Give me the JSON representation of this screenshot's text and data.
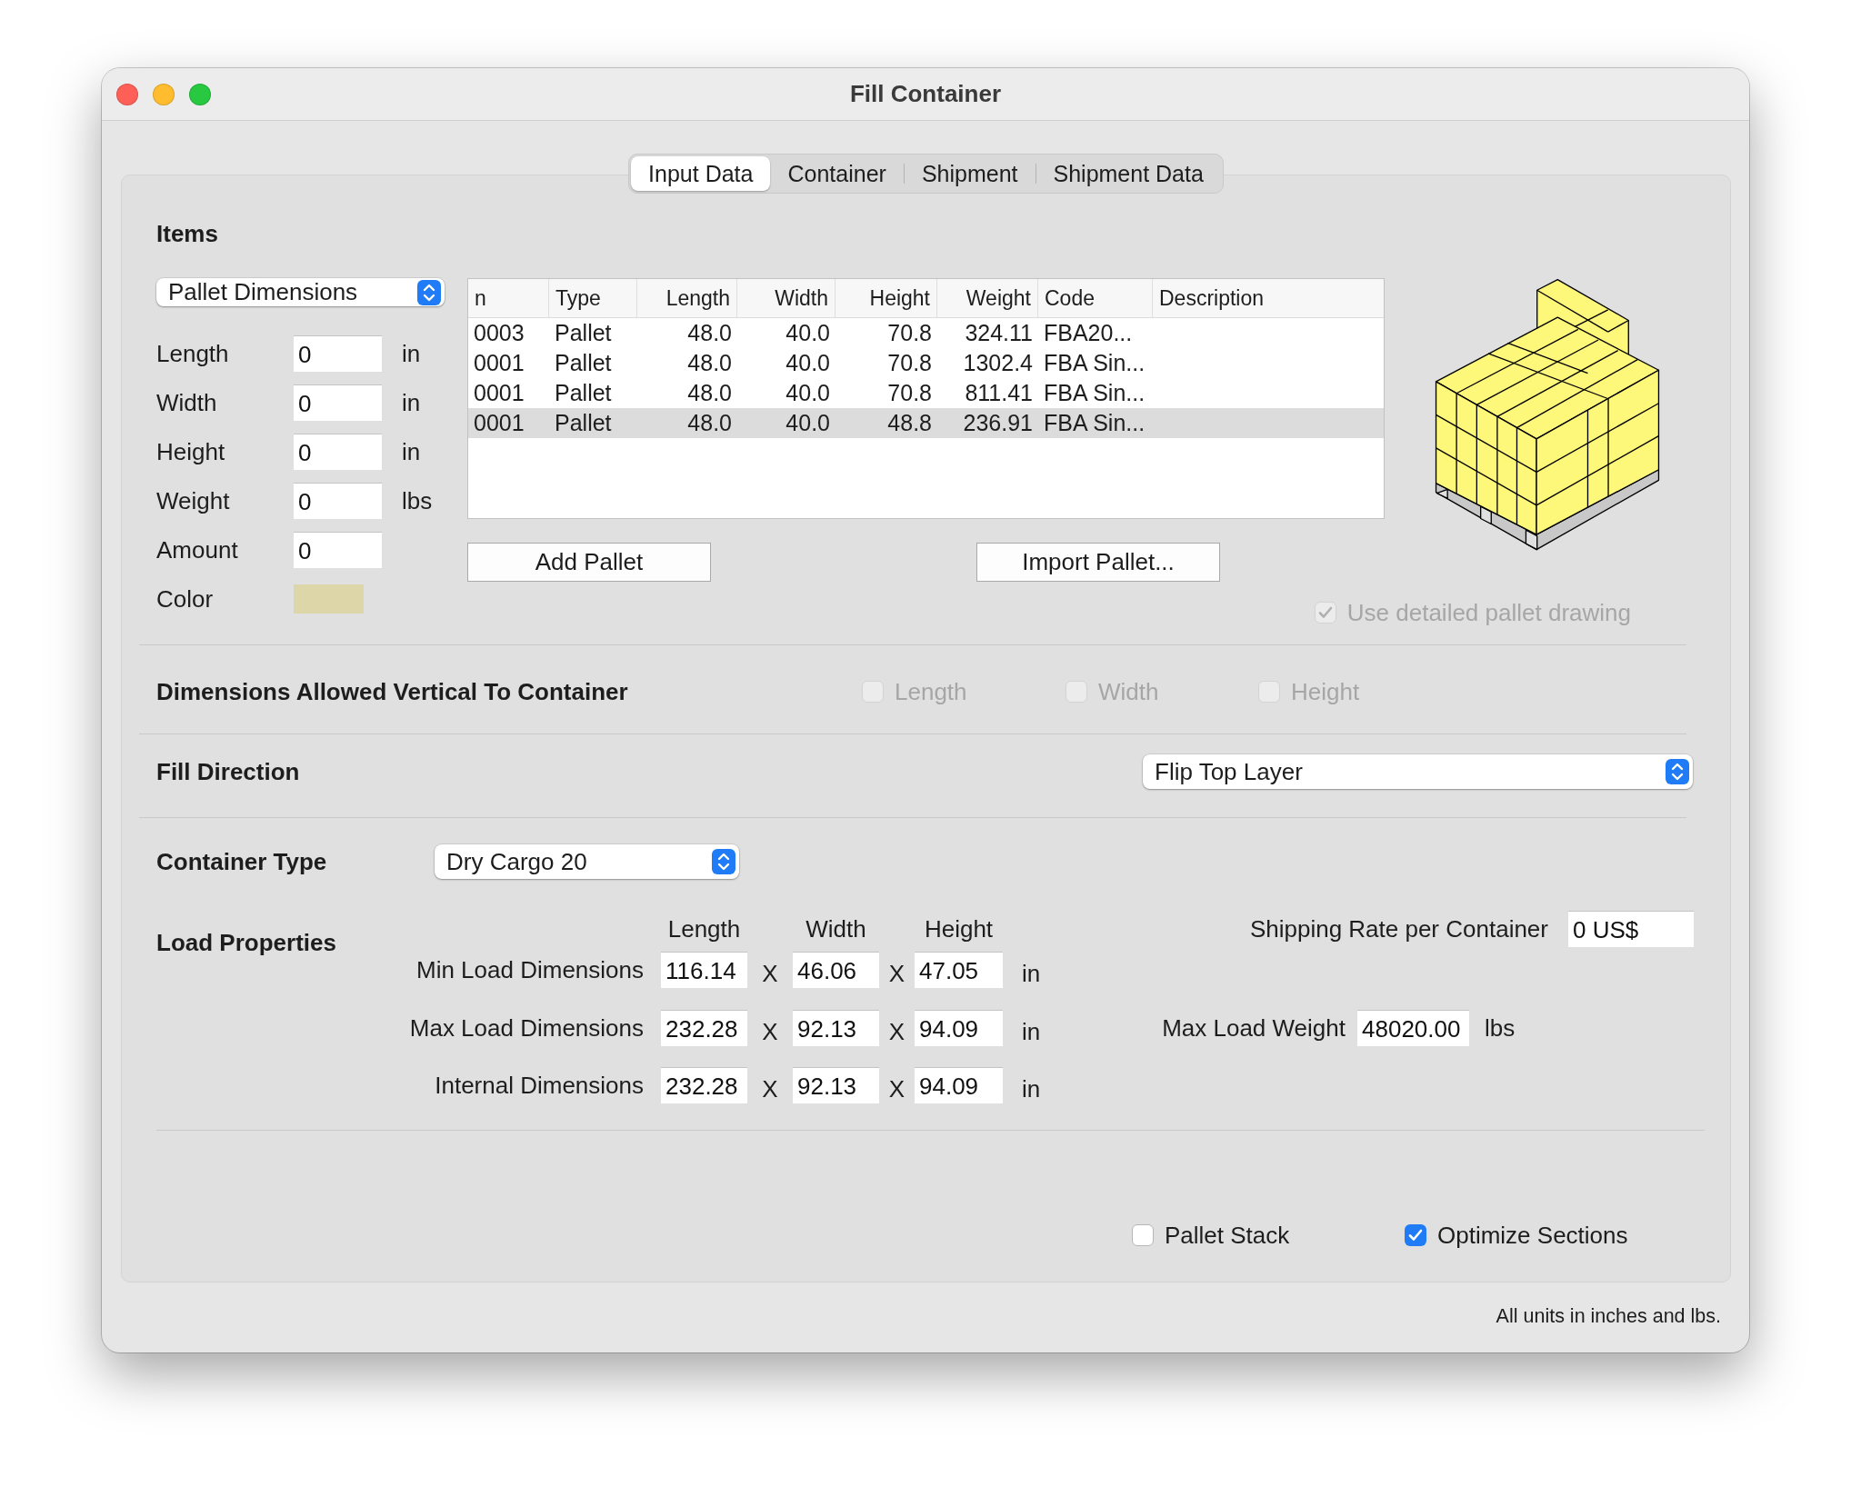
{
  "window": {
    "title": "Fill Container"
  },
  "tabs": [
    {
      "label": "Input Data",
      "selected": true
    },
    {
      "label": "Container",
      "selected": false
    },
    {
      "label": "Shipment",
      "selected": false
    },
    {
      "label": "Shipment Data",
      "selected": false
    }
  ],
  "items": {
    "heading": "Items",
    "dimension_popup": "Pallet Dimensions",
    "fields": [
      {
        "label": "Length",
        "value": "0",
        "unit": "in"
      },
      {
        "label": "Width",
        "value": "0",
        "unit": "in"
      },
      {
        "label": "Height",
        "value": "0",
        "unit": "in"
      },
      {
        "label": "Weight",
        "value": "0",
        "unit": "lbs"
      },
      {
        "label": "Amount",
        "value": "0"
      }
    ],
    "color_label": "Color",
    "color": "#ddd6a9"
  },
  "table": {
    "columns": [
      "n",
      "Type",
      "Length",
      "Width",
      "Height",
      "Weight",
      "Code",
      "Description"
    ],
    "rows": [
      {
        "cells": [
          "0003",
          "Pallet",
          "48.0",
          "40.0",
          "70.8",
          "324.11",
          "FBA20..."
        ],
        "selected": false
      },
      {
        "cells": [
          "0001",
          "Pallet",
          "48.0",
          "40.0",
          "70.8",
          "1302.4",
          "FBA Sin..."
        ],
        "selected": false
      },
      {
        "cells": [
          "0001",
          "Pallet",
          "48.0",
          "40.0",
          "70.8",
          "811.41",
          "FBA Sin..."
        ],
        "selected": false
      },
      {
        "cells": [
          "0001",
          "Pallet",
          "48.0",
          "40.0",
          "48.8",
          "236.91",
          "FBA Sin..."
        ],
        "selected": true
      }
    ]
  },
  "buttons": [
    "Add Pallet",
    "Import Pallet..."
  ],
  "detailed_drawing": {
    "label": "Use detailed pallet drawing",
    "checked": true,
    "disabled": true
  },
  "vertical": {
    "heading": "Dimensions Allowed Vertical To Container",
    "options": [
      {
        "label": "Length",
        "checked": false,
        "disabled": true
      },
      {
        "label": "Width",
        "checked": false,
        "disabled": true
      },
      {
        "label": "Height",
        "checked": false,
        "disabled": true
      }
    ]
  },
  "fill_direction": {
    "heading": "Fill Direction",
    "value": "Flip Top Layer"
  },
  "container_type": {
    "heading": "Container Type",
    "value": "Dry Cargo 20"
  },
  "load_properties": {
    "heading": "Load Properties",
    "columns": [
      "Length",
      "Width",
      "Height"
    ],
    "rows": [
      {
        "label": "Min Load Dimensions",
        "values": [
          "116.14",
          "46.06",
          "47.05"
        ],
        "times": [
          "X",
          "X"
        ],
        "unit": "in"
      },
      {
        "label": "Max Load Dimensions",
        "values": [
          "232.28",
          "92.13",
          "94.09"
        ],
        "times": [
          "X",
          "X"
        ],
        "unit": "in"
      },
      {
        "label": "Internal Dimensions",
        "values": [
          "232.28",
          "92.13",
          "94.09"
        ],
        "times": [
          "X",
          "X"
        ],
        "unit": "in"
      }
    ],
    "shipping_rate": {
      "label": "Shipping Rate per Container",
      "value": "0 US$"
    },
    "max_load_weight": {
      "label": "Max Load Weight",
      "value": "48020.00",
      "unit": "lbs"
    }
  },
  "options": [
    {
      "label": "Pallet Stack",
      "checked": false
    },
    {
      "label": "Optimize Sections",
      "checked": true
    }
  ],
  "footer": "All units in inches and lbs."
}
